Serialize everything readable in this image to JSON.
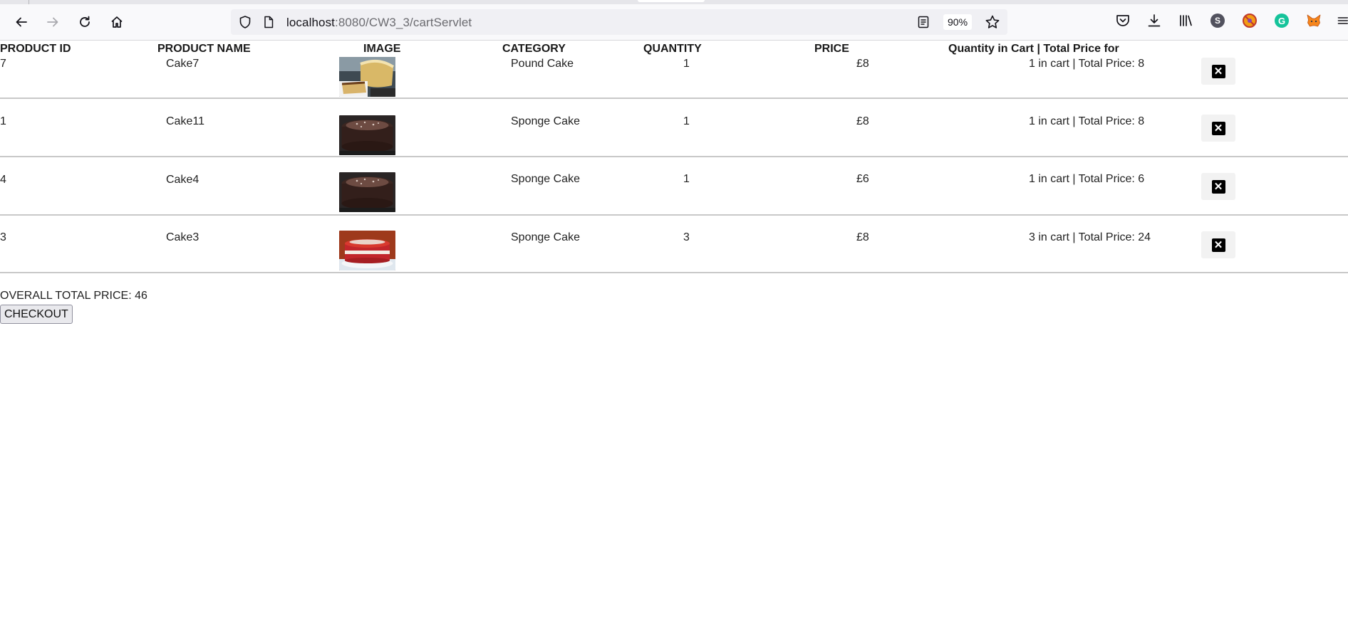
{
  "browser": {
    "url_host": "localhost",
    "url_path": ":8080/CW3_3/cartServlet",
    "zoom": "90%",
    "profile_initial": "S"
  },
  "table": {
    "headers": {
      "product_id": "PRODUCT ID",
      "product_name": "PRODUCT NAME",
      "image": "IMAGE",
      "category": "CATEGORY",
      "quantity": "QUANTITY",
      "price": "PRICE",
      "cart_total": "Quantity in Cart | Total Price for"
    },
    "rows": [
      {
        "id": "7",
        "name": "Cake7",
        "image": "pound-cake-photo",
        "category": "Pound Cake",
        "quantity": "1",
        "price": "£8",
        "cart": "1 in cart | Total Price: 8"
      },
      {
        "id": "1",
        "name": "Cake11",
        "image": "chocolate-cake-photo",
        "category": "Sponge Cake",
        "quantity": "1",
        "price": "£8",
        "cart": "1 in cart | Total Price: 8"
      },
      {
        "id": "4",
        "name": "Cake4",
        "image": "chocolate-cake-photo",
        "category": "Sponge Cake",
        "quantity": "1",
        "price": "£6",
        "cart": "1 in cart | Total Price: 6"
      },
      {
        "id": "3",
        "name": "Cake3",
        "image": "red-velvet-cake-photo",
        "category": "Sponge Cake",
        "quantity": "3",
        "price": "£8",
        "cart": "3 in cart | Total Price: 24"
      }
    ]
  },
  "summary": {
    "overall_total": "OVERALL TOTAL PRICE: 46",
    "checkout_label": "CHECKOUT"
  },
  "colors": {
    "grammarly": "#15c39a",
    "profile": "#52525e",
    "metamask": "#f6851b"
  }
}
